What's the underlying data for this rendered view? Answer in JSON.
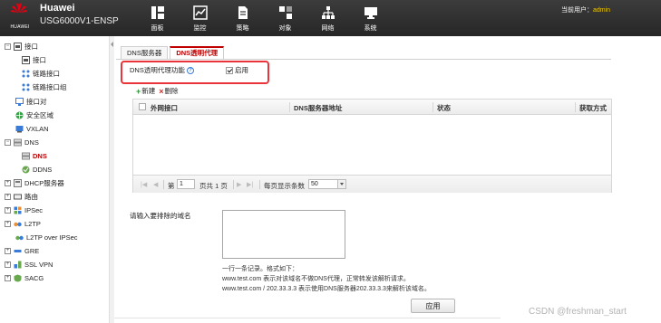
{
  "header": {
    "logo_text": "HUAWEI",
    "brand": "Huawei",
    "model": "USG6000V1-ENSP",
    "nav": [
      {
        "label": "面板",
        "icon": "dashboard-icon"
      },
      {
        "label": "监控",
        "icon": "monitor-icon"
      },
      {
        "label": "策略",
        "icon": "policy-document-icon"
      },
      {
        "label": "对象",
        "icon": "object-icon"
      },
      {
        "label": "网络",
        "icon": "network-topology-icon"
      },
      {
        "label": "系统",
        "icon": "system-computer-icon"
      }
    ],
    "user_prefix": "当前用户：",
    "user_name": "admin"
  },
  "sidebar": {
    "items": [
      {
        "label": "接口",
        "expander": "−",
        "icon": "interface-icon"
      },
      {
        "label": "接口",
        "icon": "interface-icon"
      },
      {
        "label": "链路接口",
        "icon": "link-interface-icon"
      },
      {
        "label": "链路接口组",
        "icon": "link-interface-group-icon"
      },
      {
        "label": "接口对",
        "icon": "interface-pair-icon"
      },
      {
        "label": "安全区域",
        "icon": "security-zone-icon"
      },
      {
        "label": "VXLAN",
        "icon": "vxlan-icon"
      },
      {
        "label": "DNS",
        "expander": "−",
        "icon": "dns-icon"
      },
      {
        "label": "DNS",
        "icon": "dns-icon",
        "active": true
      },
      {
        "label": "DDNS",
        "icon": "ddns-icon"
      },
      {
        "label": "DHCP服务器",
        "expander": "+",
        "icon": "dhcp-server-icon"
      },
      {
        "label": "路由",
        "expander": "+",
        "icon": "routing-icon"
      },
      {
        "label": "IPSec",
        "expander": "+",
        "icon": "ipsec-icon"
      },
      {
        "label": "L2TP",
        "expander": "+",
        "icon": "l2tp-icon"
      },
      {
        "label": "L2TP over IPSec",
        "icon": "l2tp-over-ipsec-icon"
      },
      {
        "label": "GRE",
        "expander": "+",
        "icon": "gre-icon"
      },
      {
        "label": "SSL VPN",
        "expander": "+",
        "icon": "ssl-vpn-icon"
      },
      {
        "label": "SACG",
        "expander": "+",
        "icon": "sacg-icon"
      }
    ]
  },
  "tabs": [
    {
      "label": "DNS服务器",
      "active": false
    },
    {
      "label": "DNS透明代理",
      "active": true
    }
  ],
  "transparent_proxy": {
    "label": "DNS透明代理功能",
    "help_glyph": "?",
    "enable_label": "启用",
    "enabled": true
  },
  "toolbar": {
    "add_label": "新建",
    "delete_label": "删除"
  },
  "table": {
    "columns": [
      "外网接口",
      "DNS服务器地址",
      "状态",
      "获取方式"
    ],
    "rows": []
  },
  "pager": {
    "page_prefix": "第",
    "page_value": "1",
    "page_total": "页共 1 页",
    "per_page_label": "每页显示条数",
    "per_page_value": "50"
  },
  "exclude": {
    "label": "请输入要排除的域名",
    "value": "",
    "hints": [
      "一行一条记录。格式如下：",
      "www.test.com 表示对该域名不做DNS代理，正常转发该解析请求。",
      "www.test.com / 202.33.3.3 表示使用DNS服务器202.33.3.3来解析该域名。"
    ]
  },
  "apply_label": "应用",
  "watermark": "CSDN @freshman_start",
  "colors": {
    "accent": "#c00000",
    "highlight": "#e8343a",
    "header_bg": "#2f2f2f"
  }
}
